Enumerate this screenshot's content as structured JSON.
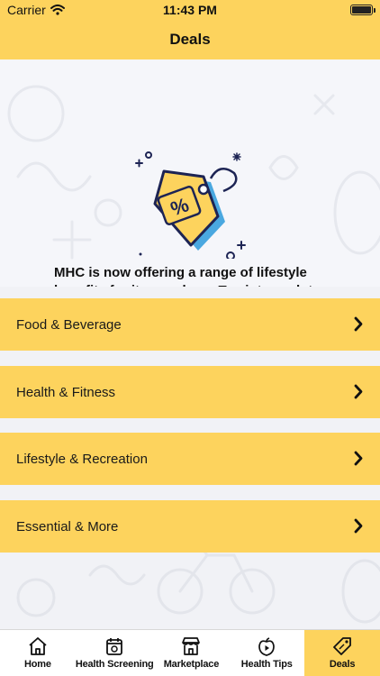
{
  "status_bar": {
    "carrier": "Carrier",
    "time": "11:43 PM"
  },
  "nav": {
    "title": "Deals"
  },
  "intro": {
    "text": "MHC is now offering a range of lifestyle benefits for its members. Tap into each to see more details!",
    "tag_symbol": "%"
  },
  "categories": [
    {
      "label": "Food & Beverage"
    },
    {
      "label": "Health & Fitness"
    },
    {
      "label": "Lifestyle & Recreation"
    },
    {
      "label": "Essential & More"
    }
  ],
  "tabs": [
    {
      "label": "Home",
      "icon": "home-icon"
    },
    {
      "label": "Health Screening",
      "icon": "calendar-icon"
    },
    {
      "label": "Marketplace",
      "icon": "store-icon"
    },
    {
      "label": "Health Tips",
      "icon": "apple-play-icon"
    },
    {
      "label": "Deals",
      "icon": "price-tag-icon",
      "active": true
    }
  ],
  "colors": {
    "accent": "#fdd35d",
    "tag_blue": "#4aa8e0",
    "text": "#111111",
    "background": "#f3f4f8"
  }
}
